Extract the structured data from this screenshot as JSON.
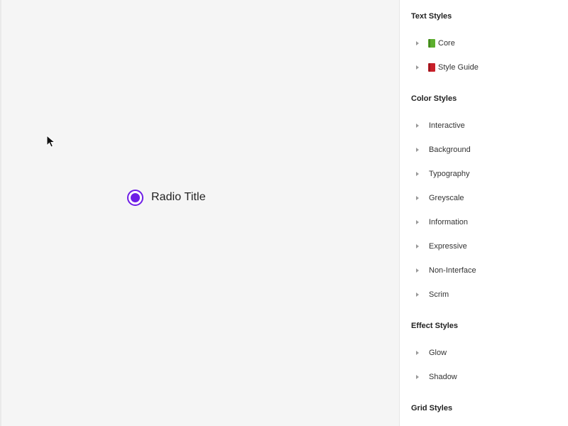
{
  "canvas": {
    "radio": {
      "label": "Radio Title",
      "accent_color": "#6e1ee6",
      "selected": true
    }
  },
  "panel": {
    "text_styles": {
      "title": "Text Styles",
      "items": [
        {
          "label": "Core",
          "icon": "green-book-icon"
        },
        {
          "label": "Style Guide",
          "icon": "red-book-icon"
        }
      ]
    },
    "color_styles": {
      "title": "Color Styles",
      "items": [
        {
          "label": "Interactive"
        },
        {
          "label": "Background"
        },
        {
          "label": "Typography"
        },
        {
          "label": "Greyscale"
        },
        {
          "label": "Information"
        },
        {
          "label": "Expressive"
        },
        {
          "label": "Non-Interface"
        },
        {
          "label": "Scrim"
        }
      ]
    },
    "effect_styles": {
      "title": "Effect Styles",
      "items": [
        {
          "label": "Glow"
        },
        {
          "label": "Shadow"
        }
      ]
    },
    "grid_styles": {
      "title": "Grid Styles"
    }
  }
}
